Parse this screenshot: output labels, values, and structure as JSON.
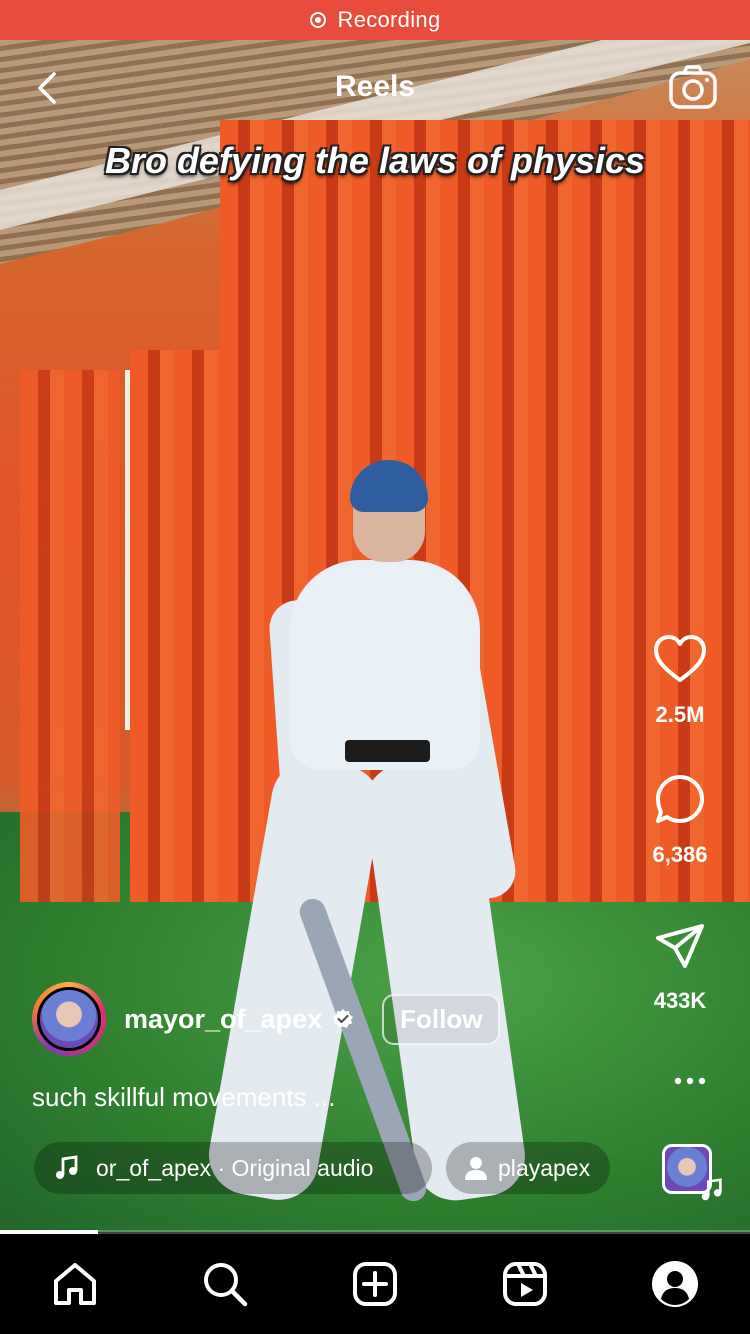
{
  "recording_bar": {
    "label": "Recording",
    "color": "#e84c3d"
  },
  "header": {
    "title": "Reels"
  },
  "video": {
    "caption_overlay": "Bro defying the laws of physics",
    "progress": 0.13
  },
  "actions": {
    "like_count": "2.5M",
    "comment_count": "6,386",
    "share_count": "433K"
  },
  "author": {
    "username": "mayor_of_apex",
    "verified": true,
    "follow_label": "Follow"
  },
  "description": "such skillful movements ...",
  "audio": {
    "label": "or_of_apex · Original audio"
  },
  "tagged_user": {
    "label": "playapex"
  },
  "nav": {
    "tabs": [
      "home-icon",
      "search-icon",
      "create-icon",
      "reels-icon",
      "profile-icon"
    ]
  }
}
